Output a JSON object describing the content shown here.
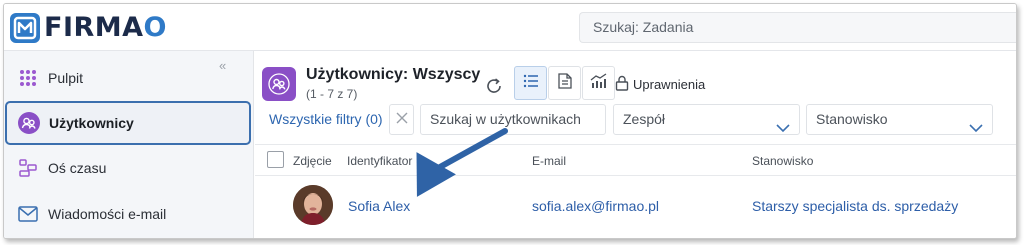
{
  "app": {
    "logo_text_main": "FIRMA",
    "logo_text_o": "O"
  },
  "topbar": {
    "search_placeholder": "Szukaj: Zadania"
  },
  "sidebar": {
    "collapse_glyph": "«",
    "items": [
      {
        "label": "Pulpit",
        "icon": "grid-dots-icon"
      },
      {
        "label": "Użytkownicy",
        "icon": "users-icon",
        "active": true
      },
      {
        "label": "Oś czasu",
        "icon": "timeline-icon"
      },
      {
        "label": "Wiadomości e-mail",
        "icon": "envelope-icon"
      }
    ]
  },
  "header": {
    "title": "Użytkownicy: Wszyscy",
    "count": "(1 - 7 z 7)",
    "permissions_label": "Uprawnienia"
  },
  "filters": {
    "all_filters": "Wszystkie filtry (0)",
    "search_placeholder": "Szukaj w użytkownikach",
    "team_select": "Zespół",
    "position_select": "Stanowisko"
  },
  "table": {
    "columns": [
      "Zdjęcie",
      "Identyfikator",
      "E-mail",
      "Stanowisko"
    ],
    "rows": [
      {
        "name": "Sofia Alex",
        "email": "sofia.alex@firmao.pl",
        "position": "Starszy specjalista ds. sprzedaży"
      }
    ]
  },
  "colors": {
    "accent": "#2d66b0",
    "purple": "#8a4fc6",
    "arrow": "#2f63a6"
  }
}
